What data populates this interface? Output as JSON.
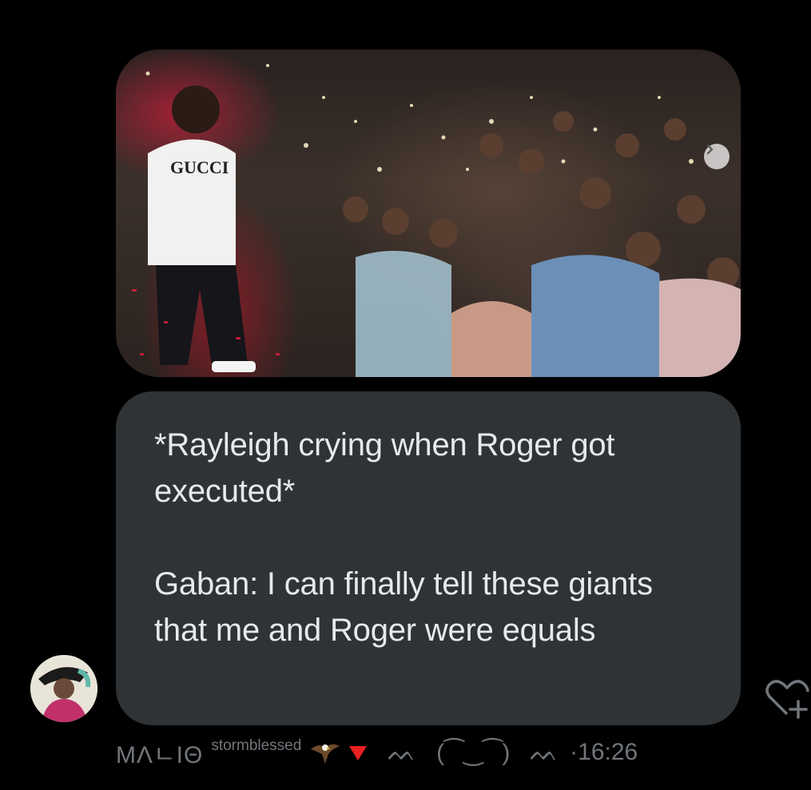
{
  "message": {
    "line1": "*Rayleigh crying when Roger got executed*",
    "line2": "Gaban: I can finally tell these giants that me and Roger were equals"
  },
  "photo": {
    "shirt_text": "GUCCI"
  },
  "footer": {
    "display_name": "MΛㄴIΘ",
    "handle": "stormblessed",
    "kaomoji": "ᨓ   (⁀‿⁀)   ᨓ",
    "time": "·16:26"
  },
  "icons": {
    "carousel_next": "chevron-right-icon",
    "react": "heart-plus-icon",
    "eagle": "eagle-emoji",
    "triangle": "red-triangle-down-emoji"
  },
  "colors": {
    "background": "#000000",
    "bubble": "#2f3336",
    "text": "#e7e9ea",
    "muted": "#71767b",
    "red_triangle": "#e8201f"
  }
}
